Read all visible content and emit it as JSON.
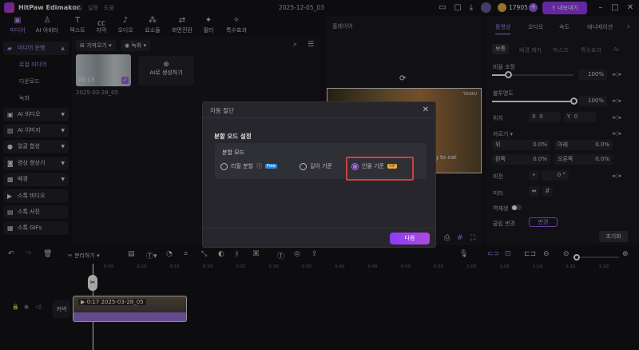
{
  "app": {
    "name": "HitPaw Edimakor",
    "menus": [
      "파일",
      "설정",
      "도움"
    ],
    "project_name": "2025-12-05_03",
    "credits": "17905",
    "export_label": "내보내기"
  },
  "toolbar_tabs": [
    {
      "label": "미디어",
      "icon": "media-icon",
      "active": true
    },
    {
      "label": "AI 아바타",
      "icon": "avatar-icon"
    },
    {
      "label": "텍스트",
      "icon": "text-icon"
    },
    {
      "label": "자막",
      "icon": "caption-icon"
    },
    {
      "label": "오디오",
      "icon": "music-icon"
    },
    {
      "label": "요소들",
      "icon": "elements-icon"
    },
    {
      "label": "화면전환",
      "icon": "transition-icon"
    },
    {
      "label": "필터",
      "icon": "filter-icon"
    },
    {
      "label": "특수효과",
      "icon": "effects-icon"
    }
  ],
  "sidebar": {
    "project_media": "미디어 운행",
    "sub_items": [
      "로컬 미디어",
      "다운로드",
      "녹화"
    ],
    "items": [
      "AI 비디오",
      "AI 이미지",
      "얼굴 합성",
      "영상 향상기",
      "배경",
      "스톡 비디오",
      "스톡 사진",
      "스톡 GIFs"
    ]
  },
  "media": {
    "import_label": "가져오기",
    "record_label": "녹화",
    "clip_duration": "00:13",
    "clip_name": "2025-03-28_05",
    "ai_generate_label": "AI로 생성하기"
  },
  "player": {
    "title": "플레이어",
    "subtitle_text": "ing to eat",
    "watermark": "YOUKU"
  },
  "right_panel": {
    "tabs": [
      "동영상",
      "오디오",
      "속도",
      "애니메이션"
    ],
    "subtabs": [
      "보통",
      "배경 제거",
      "마스크",
      "특수효과",
      "AI"
    ],
    "scale_label": "비율 조정",
    "scale_value": "100%",
    "scale_fraction": 0.2,
    "opacity_label": "불투명도",
    "opacity_value": "100%",
    "opacity_fraction": 1.0,
    "position_label": "위치",
    "x_label": "X",
    "x_value": "0",
    "y_label": "Y",
    "y_value": "0",
    "crop_label": "자르기",
    "crop": [
      {
        "label": "위",
        "value": "0.0%"
      },
      {
        "label": "아래",
        "value": "0.0%"
      },
      {
        "label": "왼쪽",
        "value": "0.0%"
      },
      {
        "label": "오른쪽",
        "value": "0.0%"
      }
    ],
    "rotate_label": "회전",
    "rotate_value": "0",
    "rotate_unit": "°",
    "mirror_label": "미러",
    "reverse_label": "역재생",
    "clip_change_label": "클립 변경",
    "change_button": "변경",
    "reset_button": "초기화"
  },
  "dialog": {
    "title": "자동 절단",
    "section": "분할 모드 설정",
    "mode_label": "분할 모드",
    "options": [
      {
        "label": "리필 분할",
        "badge": "Free",
        "selected": false
      },
      {
        "label": "길이 기준",
        "selected": false
      },
      {
        "label": "인물 기준",
        "badge": "VIP",
        "selected": true
      }
    ],
    "next_button": "다음"
  },
  "timeline": {
    "split_label": "분리하기",
    "ruler_ticks": [
      "0:05",
      "0:10",
      "0:15",
      "0:20",
      "0:25",
      "0:30",
      "0:35",
      "0:40",
      "0:45",
      "0:50",
      "0:55",
      "1:00",
      "1:05",
      "1:10",
      "1:15",
      "1:20"
    ],
    "cover_label": "커버",
    "clip_label": "0:17 2025-03-28_05"
  }
}
